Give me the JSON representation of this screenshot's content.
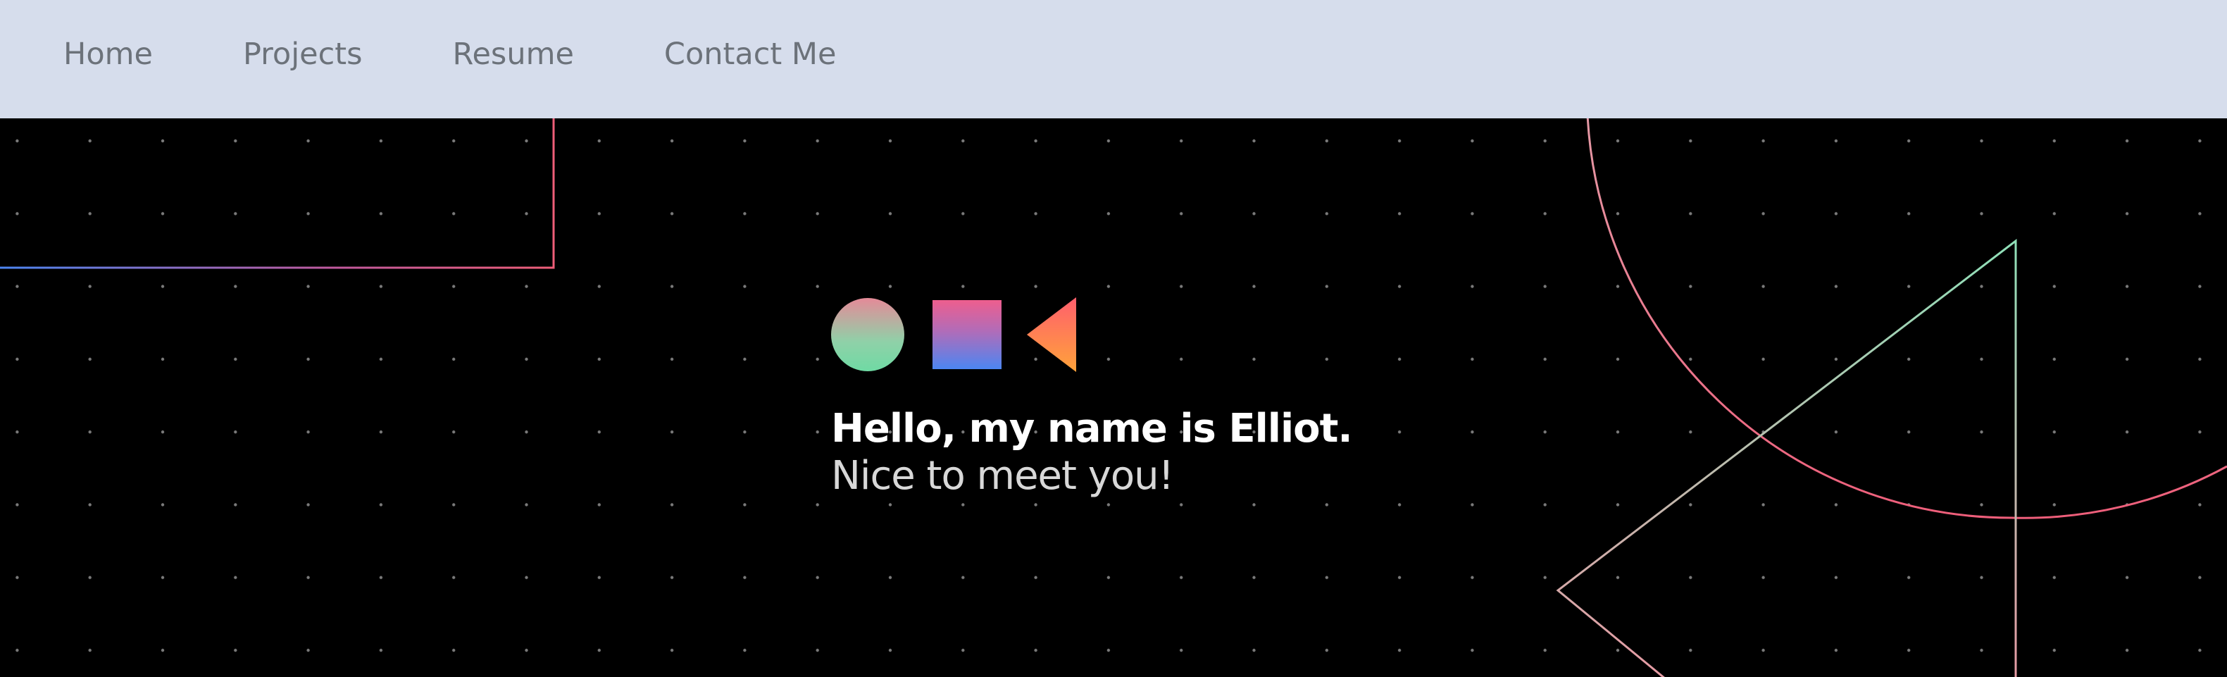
{
  "nav": {
    "items": [
      {
        "label": "Home"
      },
      {
        "label": "Projects"
      },
      {
        "label": "Resume"
      },
      {
        "label": "Contact Me"
      }
    ]
  },
  "hero": {
    "headline": "Hello, my name is Elliot.",
    "subline": "Nice to meet you!",
    "icons": [
      "circle-icon",
      "square-icon",
      "triangle-icon"
    ]
  },
  "colors": {
    "nav_background": "#d6ddec",
    "nav_text": "#6c727a",
    "hero_background": "#000000",
    "accent_pink": "#ee5e8e",
    "accent_blue": "#4c86f2",
    "accent_green": "#6fdaa4",
    "accent_orange": "#ff8a3d"
  }
}
